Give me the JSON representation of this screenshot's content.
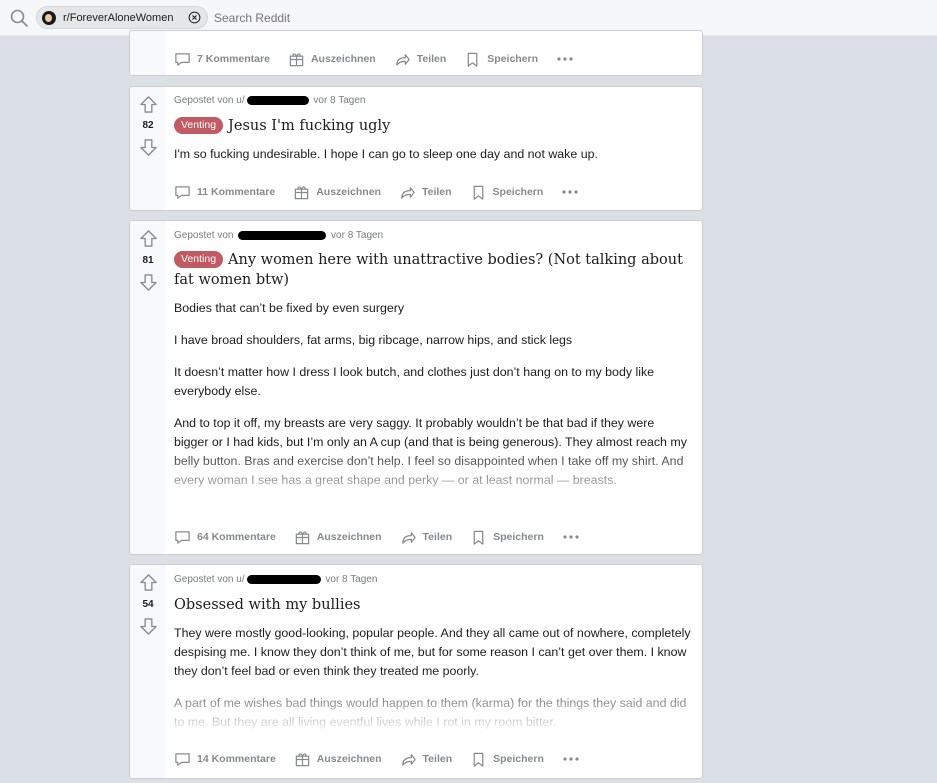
{
  "header": {
    "chip_label": "r/ForeverAloneWomen",
    "search_placeholder": "Search Reddit"
  },
  "actions": {
    "award": "Auszeichnen",
    "share": "Teilen",
    "save": "Speichern"
  },
  "posts": [
    {
      "comments": "7 Kommentare"
    },
    {
      "posted_by": "Gepostet von",
      "user_prefix": "u/",
      "age": "vor 8 Tagen",
      "score": "82",
      "flair": "Venting",
      "title": "Jesus I'm fucking ugly",
      "paragraphs": [
        "I'm so fucking undesirable. I hope I can go to sleep one day and not wake up."
      ],
      "comments": "11 Kommentare"
    },
    {
      "posted_by": "Gepostet von",
      "age": "vor 8 Tagen",
      "score": "81",
      "flair": "Venting",
      "title": "Any women here with unattractive bodies? (Not talking about fat women btw)",
      "paragraphs": [
        "Bodies that can’t be fixed by even surgery",
        "I have broad shoulders, fat arms, big ribcage, narrow hips, and stick legs",
        "It doesn’t matter how I dress I look butch, and clothes just don’t hang on to my body like everybody else.",
        "And to top it off, my breasts are very saggy. It probably wouldn’t be that bad if they were bigger or I had kids, but I’m only an A cup (and that is being generous). They almost reach my belly button. Bras and exercise don’t help. I feel so disappointed when I take off my shirt. And every woman I see has a great shape and perky — or at least normal — breasts."
      ],
      "comments": "64 Kommentare"
    },
    {
      "posted_by": "Gepostet von",
      "user_prefix": "u/",
      "age": "vor 8 Tagen",
      "score": "54",
      "title": "Obsessed with my bullies",
      "paragraphs": [
        "They were mostly good-looking, popular people. And they all came out of nowhere, completely despising me. I know they don’t think of me, but for some reason I can’t get over them. I know they don’t feel bad or even think they treated me poorly.",
        "A part of me wishes bad things would happen to them (karma) for the things they said and did to me. But they are all living eventful lives while I rot in my room bitter."
      ],
      "comments": "14 Kommentare"
    }
  ]
}
